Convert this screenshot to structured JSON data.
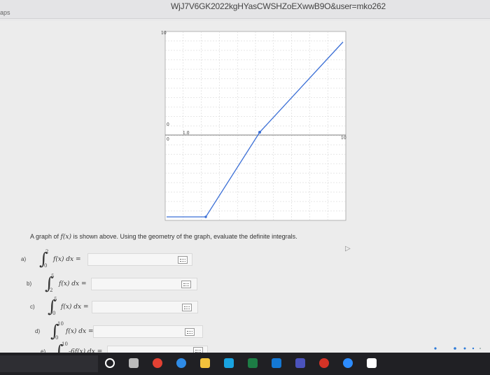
{
  "browser": {
    "url_fragment": "WjJ7V6GK2022kgHYasCWSHZoEXwwB9O&user=mko262",
    "apps_label": "aps"
  },
  "graph": {
    "y_top_label": "10",
    "y_mid_label": "0",
    "x_right_label": "10",
    "x_left_label": "0",
    "x_mid_label": "1.0",
    "line_color": "#3b6fd6"
  },
  "question": {
    "prefix": "A graph of ",
    "func": "f(x)",
    "suffix": " is shown above. Using the geometry of the graph, evaluate the definite integrals."
  },
  "parts": [
    {
      "label": "a)",
      "lower": "0",
      "upper": "2",
      "integrand": "f(x) dx ="
    },
    {
      "label": "b)",
      "lower": "2",
      "upper": "5",
      "integrand": "f(x) dx ="
    },
    {
      "label": "c)",
      "lower": "0",
      "upper": "5",
      "integrand": "f(x) dx ="
    },
    {
      "label": "d)",
      "lower": "0",
      "upper": "10",
      "integrand": "f(x) dx ="
    },
    {
      "label": "e)",
      "lower": "0",
      "upper": "10",
      "integrand": "-6f(x) dx ="
    }
  ],
  "taskbar": {
    "icons": [
      {
        "name": "circle-icon",
        "color": "#ffffff"
      },
      {
        "name": "calculator-icon",
        "color": "#bbbbbb"
      },
      {
        "name": "chrome-icon",
        "color": "#e34133"
      },
      {
        "name": "edge-icon",
        "color": "#2f8be6"
      },
      {
        "name": "files-icon",
        "color": "#f2c23c"
      },
      {
        "name": "store-icon",
        "color": "#19a3e0"
      },
      {
        "name": "excel-icon",
        "color": "#1d7d45"
      },
      {
        "name": "outlook-icon",
        "color": "#1478d4"
      },
      {
        "name": "teams-icon",
        "color": "#4b53bc"
      },
      {
        "name": "opera-icon",
        "color": "#d43326"
      },
      {
        "name": "zoom-icon",
        "color": "#2d8cff"
      },
      {
        "name": "settings-icon",
        "color": "#ffffff"
      }
    ]
  }
}
